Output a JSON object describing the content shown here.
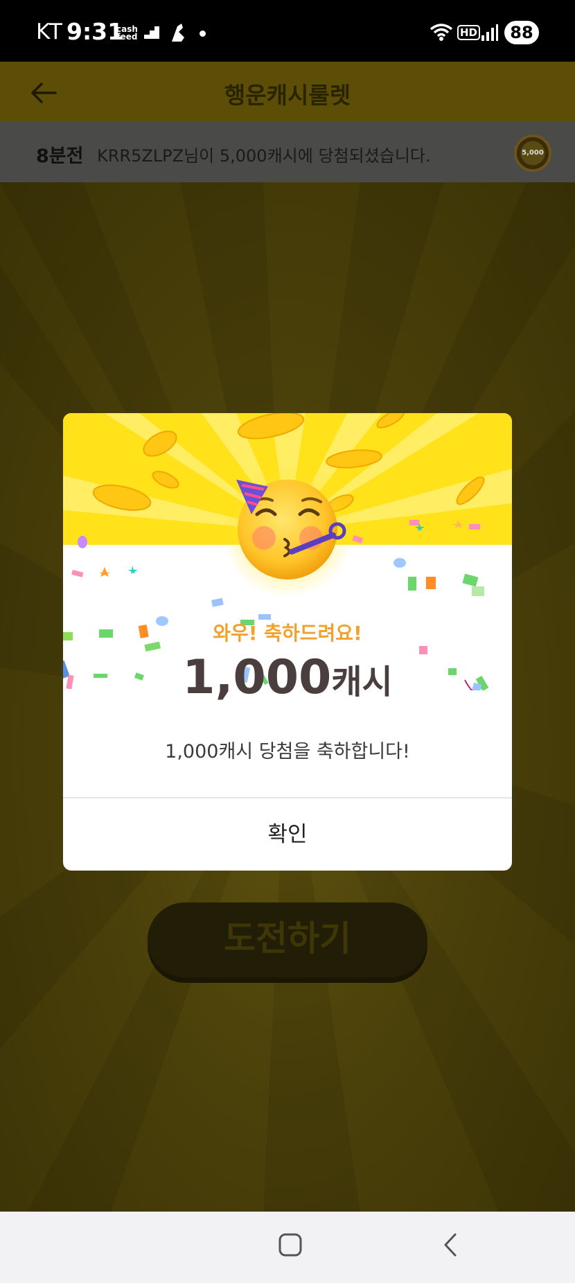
{
  "status_bar": {
    "carrier": "KT",
    "time": "9:31",
    "cashfeed_top": "cash",
    "cashfeed_bottom": "feed",
    "network_badge": "HD",
    "battery": "88"
  },
  "header": {
    "title": "행운캐시룰렛"
  },
  "ticker": {
    "time_ago": "8분전",
    "message": "KRR5ZLPZ님이 5,000캐시에 당첨되셨습니다.",
    "chip_label": "5,000"
  },
  "dialog": {
    "headline": "와우! 축하드려요!",
    "amount_number": "1,000",
    "amount_unit": "캐시",
    "message": "1,000캐시 당첨을 축하합니다!",
    "confirm_label": "확인"
  },
  "main": {
    "challenge_label": "도전하기"
  },
  "colors": {
    "dialog_yellow": "#ffe21a",
    "headline_orange": "#f1a12e",
    "amount_text": "#4a3f3e"
  }
}
